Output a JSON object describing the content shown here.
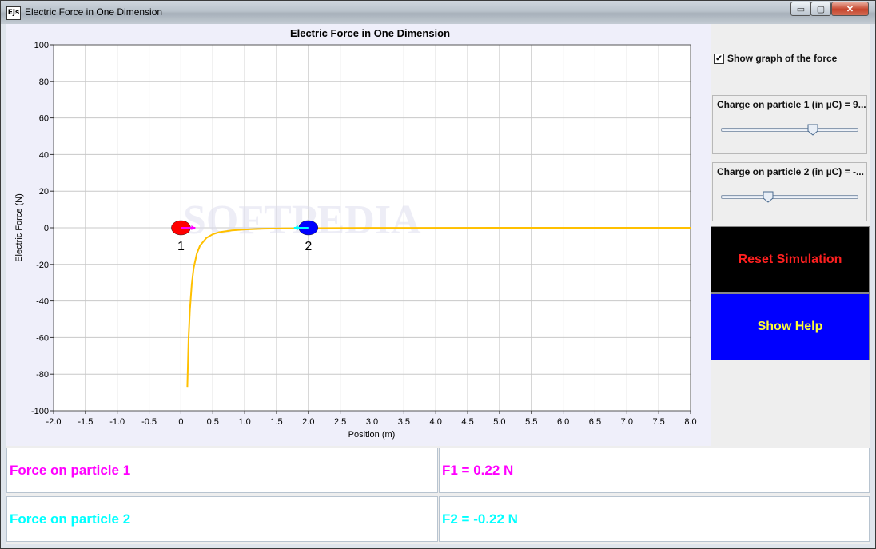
{
  "window": {
    "title": "Electric Force in One Dimension",
    "icon_label": "Ejs",
    "controls": {
      "minimize": "▭",
      "maximize": "▢",
      "close": "✕"
    }
  },
  "plot": {
    "title": "Electric Force in One Dimension",
    "x_label": "Position (m)",
    "y_label": "Electric Force (N)",
    "watermark": "SOFTPEDIA",
    "particle_1_label": "1",
    "particle_2_label": "2"
  },
  "chart_data": {
    "type": "line",
    "title": "Electric Force in One Dimension",
    "xlabel": "Position (m)",
    "ylabel": "Electric Force (N)",
    "xlim": [
      -2.0,
      8.0
    ],
    "ylim": [
      -100,
      100
    ],
    "x_ticks": [
      "-2.0",
      "-1.5",
      "-1.0",
      "-0.5",
      "0",
      "0.5",
      "1.0",
      "1.5",
      "2.0",
      "2.5",
      "3.0",
      "3.5",
      "4.0",
      "4.5",
      "5.0",
      "5.5",
      "6.0",
      "6.5",
      "7.0",
      "7.5",
      "8.0"
    ],
    "y_ticks": [
      "100",
      "80",
      "60",
      "40",
      "20",
      "0",
      "-20",
      "-40",
      "-60",
      "-80",
      "-100"
    ],
    "grid": true,
    "series": [
      {
        "color": "#ffc000",
        "points": [
          [
            0.1,
            -87
          ],
          [
            0.12,
            -60
          ],
          [
            0.14,
            -45
          ],
          [
            0.17,
            -31
          ],
          [
            0.2,
            -22
          ],
          [
            0.25,
            -14
          ],
          [
            0.3,
            -9.7
          ],
          [
            0.4,
            -5.5
          ],
          [
            0.5,
            -3.5
          ],
          [
            0.6,
            -2.4
          ],
          [
            0.8,
            -1.4
          ],
          [
            1.0,
            -0.9
          ],
          [
            1.3,
            -0.5
          ],
          [
            1.6,
            -0.3
          ],
          [
            2.0,
            -0.22
          ],
          [
            3.0,
            -0.05
          ],
          [
            5.0,
            0
          ],
          [
            8.0,
            0
          ]
        ]
      }
    ],
    "particles": [
      {
        "label": "1",
        "x": 0.0,
        "y": 0,
        "color": "#ff0000",
        "arrow_color": "#ff00ff"
      },
      {
        "label": "2",
        "x": 2.0,
        "y": 0,
        "color": "#0000ff",
        "arrow_color": "#00ffff"
      }
    ]
  },
  "controls": {
    "show_graph_label": "Show graph of the force",
    "show_graph_checked": true,
    "slider1": {
      "label": "Charge on particle 1 (in µC) = 9...",
      "value_fraction": 0.67
    },
    "slider2": {
      "label": "Charge on particle 2 (in µC) = -...",
      "value_fraction": 0.34
    },
    "reset_label": "Reset Simulation",
    "help_label": "Show Help"
  },
  "readouts": {
    "force1_label": "Force on particle 1",
    "force1_value": "F1 = 0.22 N",
    "force2_label": "Force on particle 2",
    "force2_value": "F2 = -0.22 N",
    "force1_color": "#ff00ff",
    "force2_color": "#00ffff"
  }
}
